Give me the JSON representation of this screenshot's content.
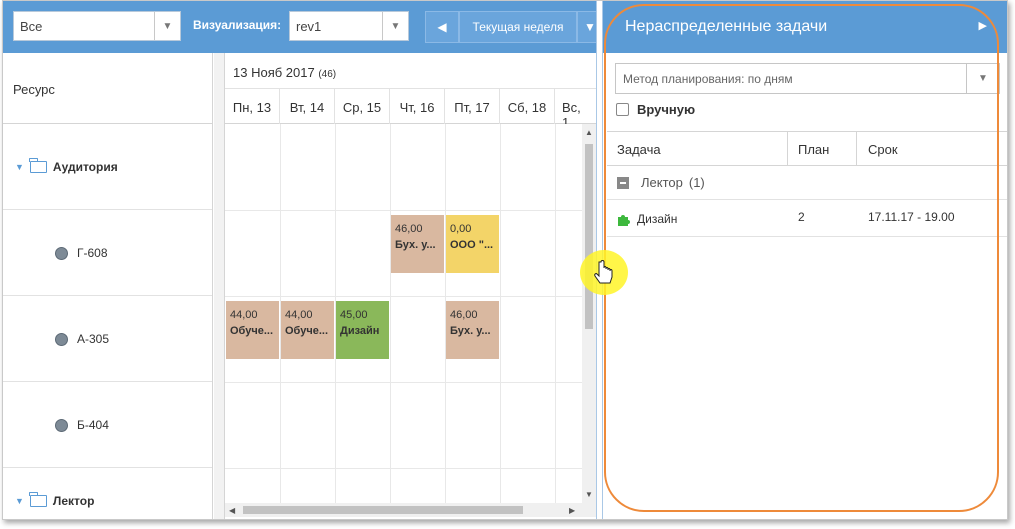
{
  "toolbar": {
    "filter_value": "Все",
    "visualization_label": "Визуализация:",
    "visualization_value": "rev1",
    "period_label": "Текущая неделя"
  },
  "resources": {
    "header": "Ресурс",
    "group1": "Аудитория",
    "items": [
      "Г-608",
      "А-305",
      "Б-404"
    ],
    "group2": "Лектор"
  },
  "calendar": {
    "title": "13 Нояб 2017",
    "week_number": "(46)",
    "days": [
      "Пн, 13",
      "Вт, 14",
      "Ср, 15",
      "Чт, 16",
      "Пт, 17",
      "Сб, 18",
      "Вс, 1"
    ],
    "events": [
      {
        "value": "46,00",
        "label": "Бух. у...",
        "color": "#d9b8a0"
      },
      {
        "value": "0,00",
        "label": "ООО \"...",
        "color": "#f3d468"
      },
      {
        "value": "44,00",
        "label": "Обуче...",
        "color": "#d9b8a0"
      },
      {
        "value": "44,00",
        "label": "Обуче...",
        "color": "#d9b8a0"
      },
      {
        "value": "45,00",
        "label": "Дизайн",
        "color": "#8ab85a"
      },
      {
        "value": "46,00",
        "label": "Бух. у...",
        "color": "#d9b8a0"
      }
    ]
  },
  "panel": {
    "title": "Нераспределенные задачи",
    "method_value": "Метод планирования: по дням",
    "manual_label": "Вручную",
    "columns": [
      "Задача",
      "План",
      "Срок"
    ],
    "group": "Лектор",
    "group_count": "(1)",
    "rows": [
      {
        "task": "Дизайн",
        "plan": "2",
        "deadline": "17.11.17 - 19.00"
      }
    ]
  },
  "colors": {
    "accent": "#5b9bd5",
    "highlight": "#ee8a3a"
  }
}
